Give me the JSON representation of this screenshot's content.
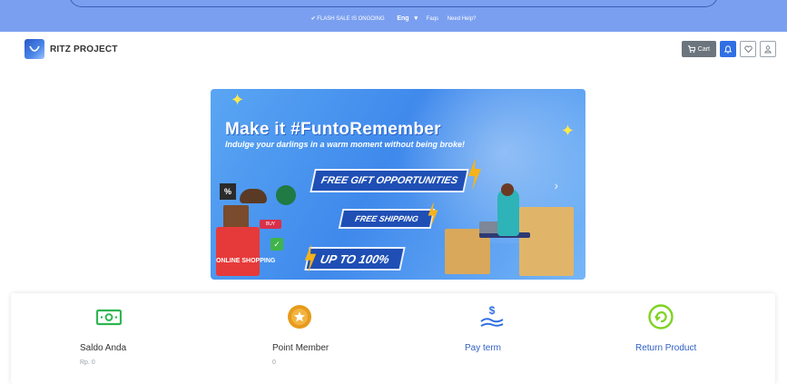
{
  "topbar": {
    "flash_sale": "✔ FLASH SALE IS ONGOING",
    "language": "Eng",
    "faqs": "Faqs",
    "need_help": "Need Help?"
  },
  "navbar": {
    "brand": "RITZ PROJECT",
    "cart_label": "Cart"
  },
  "banner": {
    "headline": "Make it #FuntoRemember",
    "subheadline": "Indulge your darlings in a warm moment without being broke!",
    "tag_gift": "FREE GIFT OPPORTUNITIES",
    "tag_shipping": "FREE SHIPPING",
    "tag_discount": "UP TO 100%",
    "bag_text": "ONLINE SHOPPING",
    "percent_badge": "%",
    "buy_badge": "BUY"
  },
  "features": [
    {
      "title": "Saldo Anda",
      "value": "Rp. 0",
      "icon": "money-icon",
      "color": "#2fb552"
    },
    {
      "title": "Point Member",
      "value": "0",
      "icon": "medal-icon",
      "color": "#e79a1c"
    },
    {
      "title": "Pay term",
      "value": "",
      "icon": "hand-dollar-icon",
      "color": "#2f6fe4"
    },
    {
      "title": "Return Product",
      "value": "",
      "icon": "return-icon",
      "color": "#7ed321"
    }
  ],
  "colors": {
    "topbar": "#7b9ff0",
    "primary": "#2f6fe4",
    "cart_button": "#6c757d"
  }
}
